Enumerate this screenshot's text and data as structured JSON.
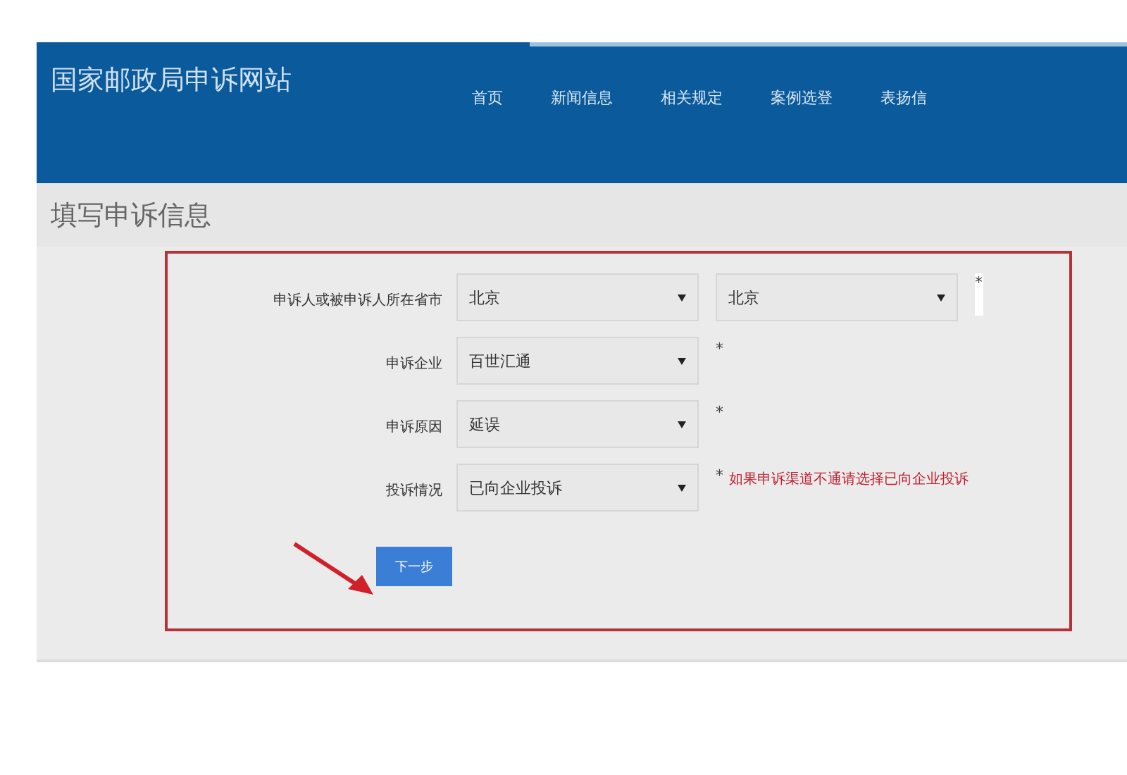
{
  "header": {
    "site_title": "国家邮政局申诉网站",
    "nav": [
      {
        "label": "首页"
      },
      {
        "label": "新闻信息"
      },
      {
        "label": "相关规定"
      },
      {
        "label": "案例选登"
      },
      {
        "label": "表扬信"
      }
    ]
  },
  "page_title": "填写申诉信息",
  "form": {
    "rows": [
      {
        "label": "申诉人或被申诉人所在省市",
        "selects": [
          "北京",
          "北京"
        ],
        "required": "*",
        "note": ""
      },
      {
        "label": "申诉企业",
        "selects": [
          "百世汇通"
        ],
        "required": "*",
        "note": ""
      },
      {
        "label": "申诉原因",
        "selects": [
          "延误"
        ],
        "required": "*",
        "note": ""
      },
      {
        "label": "投诉情况",
        "selects": [
          "已向企业投诉"
        ],
        "required": "*",
        "note": "如果申诉渠道不通请选择已向企业投诉"
      }
    ],
    "next_button": "下一步"
  }
}
